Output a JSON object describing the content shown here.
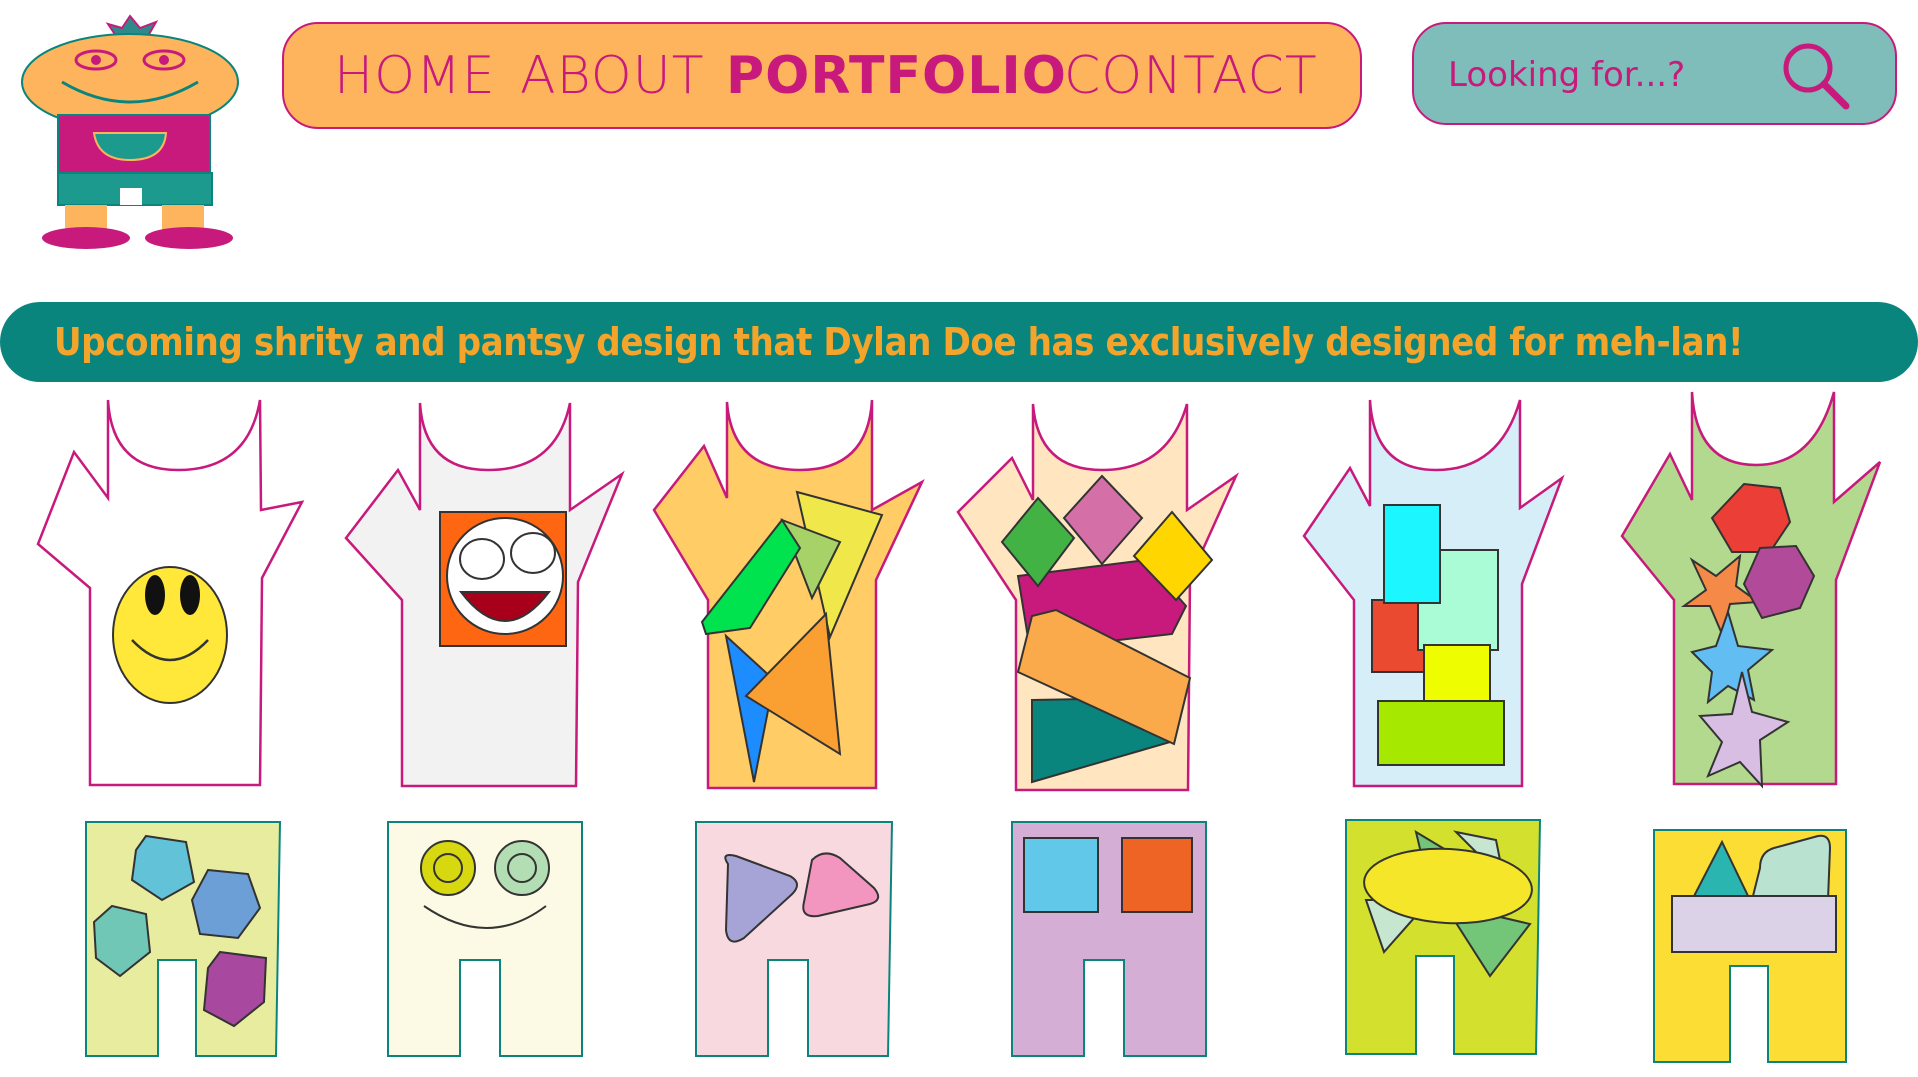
{
  "brand": {
    "name": "meh-lan",
    "logo_icon": "robot-mascot-icon",
    "colors": {
      "orange": "#FDB45C",
      "magenta": "#C71A7C",
      "teal": "#0A857D",
      "teal_light": "#7FBDBA",
      "banner_text": "#F5A42B"
    }
  },
  "nav": {
    "items": [
      {
        "label": "HOME",
        "active": false
      },
      {
        "label": "ABOUT",
        "active": false
      },
      {
        "label": "PORTFOLIO",
        "active": true
      },
      {
        "label": "CONTACT",
        "active": false
      }
    ]
  },
  "search": {
    "placeholder": "Looking for...?",
    "icon": "search-icon"
  },
  "banner": {
    "text": "Upcoming shrity and pantsy design that Dylan Doe has exclusively designed for meh-lan!"
  },
  "designs": {
    "shirts": [
      {
        "name": "shirt-smiley",
        "bg": "#FFFFFF",
        "motif": "smiley-face"
      },
      {
        "name": "shirt-laughing",
        "bg": "#F2F2F2",
        "motif": "laughing-face"
      },
      {
        "name": "shirt-triangles",
        "bg": "#FFCC66",
        "motif": "triangles"
      },
      {
        "name": "shirt-diamonds",
        "bg": "#FFE6C0",
        "motif": "diamonds-and-bars"
      },
      {
        "name": "shirt-blocks",
        "bg": "#D6EEF8",
        "motif": "stacked-blocks"
      },
      {
        "name": "shirt-stars",
        "bg": "#B3D98E",
        "motif": "hexagons-and-stars"
      }
    ],
    "pants": [
      {
        "name": "pants-hexagons",
        "bg": "#E8EC9E",
        "motif": "hexagons"
      },
      {
        "name": "pants-eyes",
        "bg": "#FCFAE4",
        "motif": "eyes-smile"
      },
      {
        "name": "pants-triangles",
        "bg": "#F8D9DF",
        "motif": "rounded-triangles"
      },
      {
        "name": "pants-squares",
        "bg": "#D4AED4",
        "motif": "squares"
      },
      {
        "name": "pants-ellipse",
        "bg": "#D4E02E",
        "motif": "ellipse-and-triangles"
      },
      {
        "name": "pants-shapes",
        "bg": "#FBDD33",
        "motif": "triangle-and-bar"
      }
    ]
  }
}
